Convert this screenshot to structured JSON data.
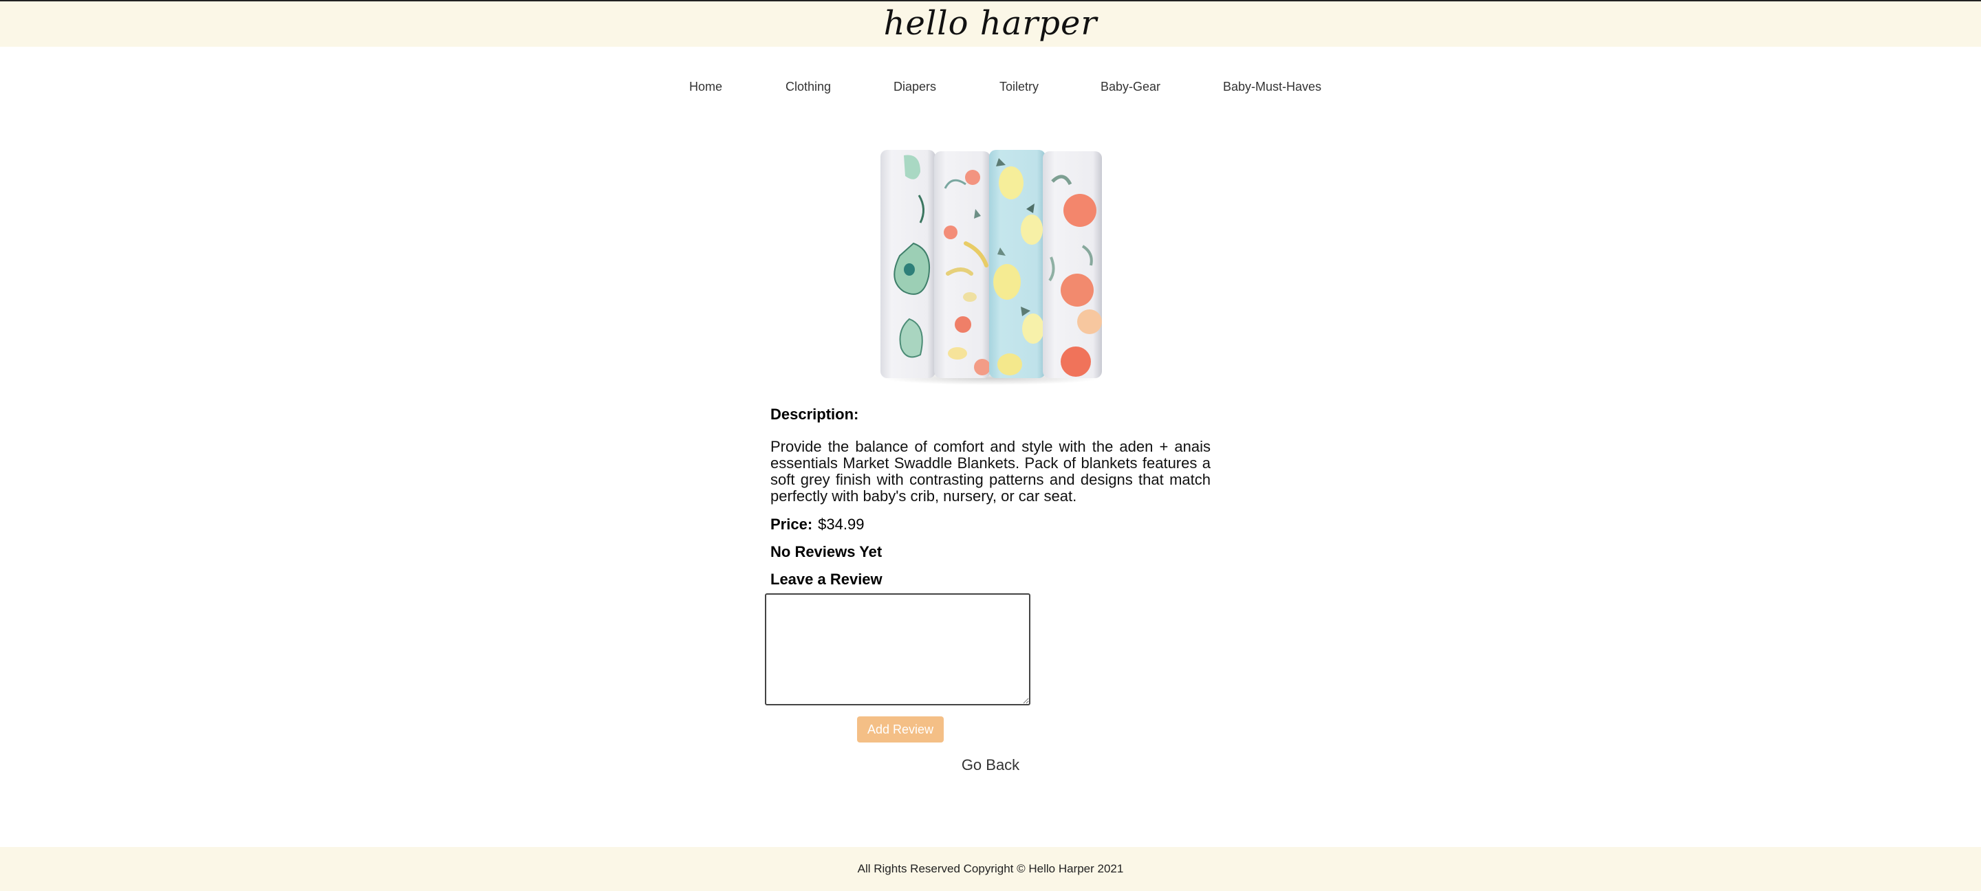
{
  "header": {
    "logo_text": "hello harper"
  },
  "nav": {
    "items": [
      {
        "label": "Home"
      },
      {
        "label": "Clothing"
      },
      {
        "label": "Diapers"
      },
      {
        "label": "Toiletry"
      },
      {
        "label": "Baby-Gear"
      },
      {
        "label": "Baby-Must-Haves"
      }
    ]
  },
  "product": {
    "image_alt": "swaddle-blankets-image",
    "description_heading": "Description:",
    "description": "Provide the balance of comfort and style with the aden + anais essentials Market Swaddle Blankets. Pack of blankets features a soft grey finish with contrasting patterns and designs that match perfectly with baby's crib, nursery, or car seat.",
    "price_label": "Price:",
    "price_value": "$34.99",
    "reviews_status": "No Reviews Yet",
    "leave_review_heading": "Leave a Review"
  },
  "review_form": {
    "textarea_value": "",
    "add_button_label": "Add Review"
  },
  "go_back_label": "Go Back",
  "footer": {
    "text": "All Rights Reserved Copyright © Hello Harper 2021"
  },
  "colors": {
    "header_bg": "#fbf7e7",
    "footer_bg": "#fbf7e7",
    "button_bg": "#f4bf86"
  }
}
